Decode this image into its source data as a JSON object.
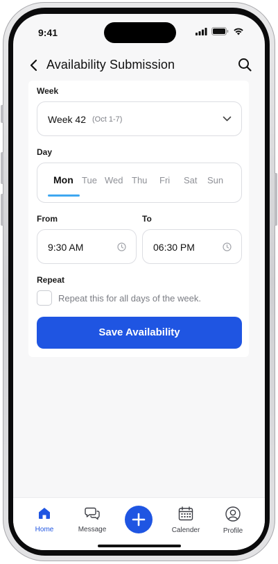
{
  "status_bar": {
    "time": "9:41"
  },
  "header": {
    "title": "Availability Submission",
    "back_icon": "chevron-left-icon",
    "search_icon": "search-icon"
  },
  "form": {
    "week": {
      "label": "Week",
      "value": "Week 42",
      "range": "(Oct 1-7)"
    },
    "day": {
      "label": "Day",
      "options": [
        "Mon",
        "Tue",
        "Wed",
        "Thu",
        "Fri",
        "Sat",
        "Sun"
      ],
      "selected": "Mon"
    },
    "from": {
      "label": "From",
      "value": "9:30 AM"
    },
    "to": {
      "label": "To",
      "value": "06:30 PM"
    },
    "repeat": {
      "label": "Repeat",
      "checkbox_text": "Repeat this for all days of the week.",
      "checked": false
    },
    "save_label": "Save Availability"
  },
  "tabs": [
    {
      "label": "Home",
      "icon": "home-icon",
      "active": true
    },
    {
      "label": "Message",
      "icon": "message-icon",
      "active": false
    },
    {
      "label": "",
      "icon": "plus-icon",
      "active": false
    },
    {
      "label": "Calender",
      "icon": "calendar-icon",
      "active": false
    },
    {
      "label": "Profile",
      "icon": "profile-icon",
      "active": false
    }
  ],
  "colors": {
    "accent": "#1f55e2",
    "day_underline": "#3ea7f0",
    "background": "#f7f7f8"
  }
}
